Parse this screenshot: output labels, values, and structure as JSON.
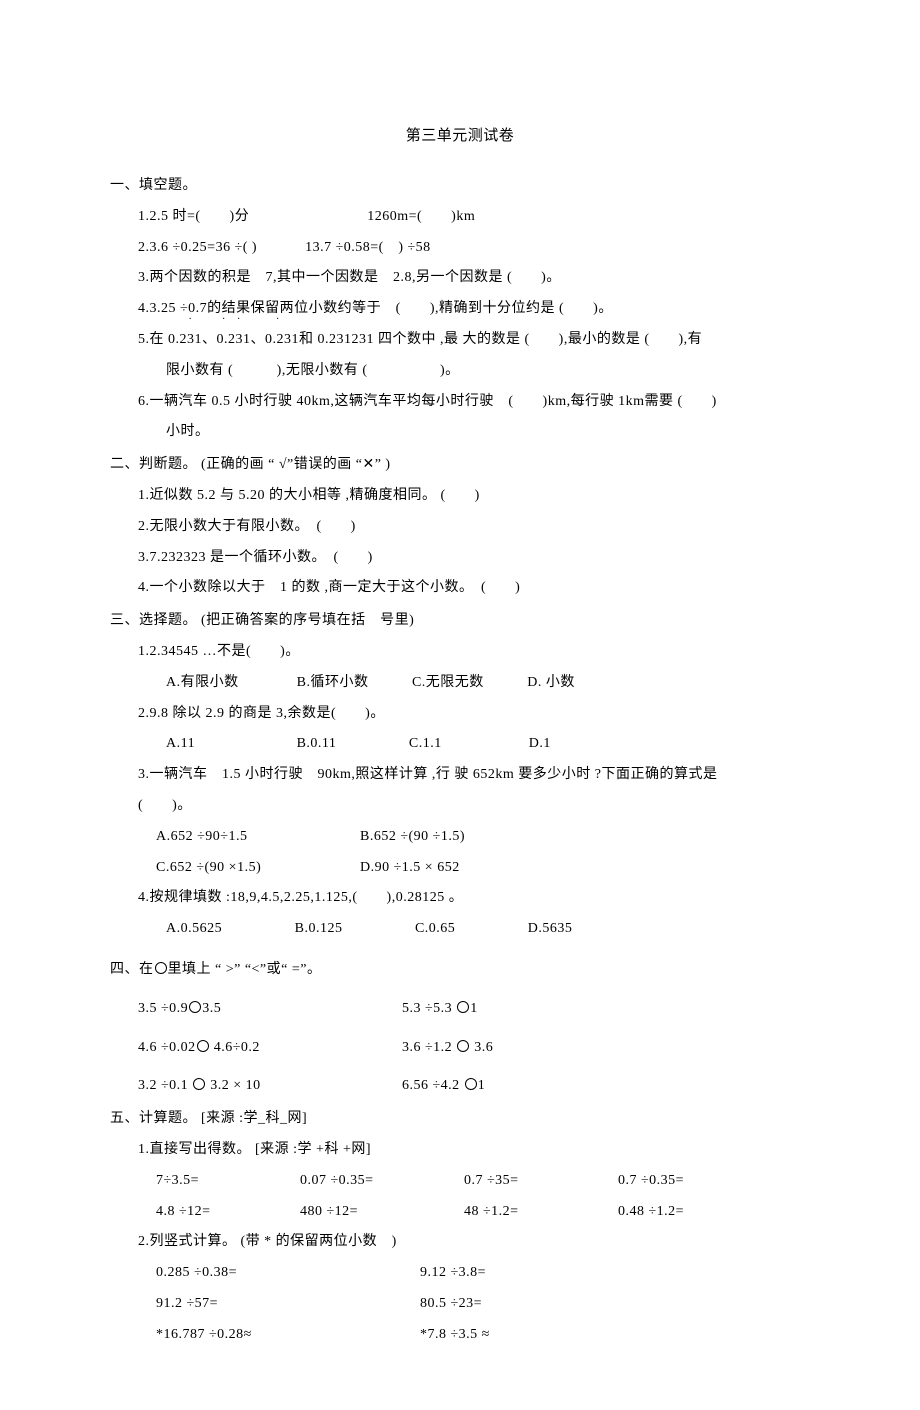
{
  "title": "第三单元测试卷",
  "s1": {
    "head": "一、填空题。",
    "q1a": "1.2.5 时=(　　)分",
    "q1b": "1260m=(　　)km",
    "q2a": "2.3.6 ÷0.25=36 ÷( )",
    "q2b": "13.7 ÷0.58=(　) ÷58",
    "q3": "3.两个因数的积是　7,其中一个因数是　2.8,另一个因数是 (　　)。",
    "q4": "4.3.25 ÷0.7的结果保留两位小数约等于　(　　),精确到十分位约是 (　　)。",
    "q5a": "5.在 0.23",
    "q5b": "、0.",
    "q5c": "3",
    "q5d": "、0.2",
    "q5e": "和 0.231231 四个数中 ,最 大的数是 (　　),最小的数是 (　　),有",
    "q5f": "限小数有 (　　　),无限小数有 (　　　　　)。",
    "q6a": "6.一辆汽车 0.5 小时行驶 40km,这辆汽车平均每小时行驶　(　　)km,每行驶 1km需要 (　　)",
    "q6b": "小时。"
  },
  "s2": {
    "head": "二、判断题。 (正确的画 “ √”错误的画 “✕” )",
    "q1": "1.近似数 5.2 与 5.20 的大小相等 ,精确度相同。 (　　)",
    "q2": "2.无限小数大于有限小数。　(　　)",
    "q3": "3.7.232323 是一个循环小数。　(　　)",
    "q4": "4.一个小数除以大于　1 的数 ,商一定大于这个小数。　(　　)"
  },
  "s3": {
    "head": "三、选择题。 (把正确答案的序号填在括　号里)",
    "q1": "1.2.34545 …不是(　　)。",
    "q1o": "A.有限小数　　　　B.循环小数　　　C.无限无数　　　D. 小数",
    "q2": "2.9.8 除以 2.9 的商是 3,余数是(　　)。",
    "q2o": "A.11　　　　　　　B.0.11　　　　　C.1.1　　　　　　D.1",
    "q3a": "3.一辆汽车　1.5 小时行驶　90km,照这样计算 ,行 驶 652km 要多少小时 ?下面正确的算式是",
    "q3b": "(　　)。",
    "q3oA": "A.652 ÷90÷1.5",
    "q3oB": "B.652 ÷(90 ÷1.5)",
    "q3oC": "C.652 ÷(90 ×1.5)",
    "q3oD": "D.90 ÷1.5 × 652",
    "q4": "4.按规律填数 :18,9,4.5,2.25,1.125,(　　),0.28125 。",
    "q4o": "A.0.5625　　　　　B.0.125　　　　　C.0.65　　　　　D.5635"
  },
  "s4": {
    "head_a": "四、在",
    "head_b": "里填上 “ >” “<”或“ =”。",
    "r1a": "3.5 ÷0.9",
    "r1a2": "3.5",
    "r1b": "5.3 ÷5.3 ",
    "r1b2": "1",
    "r2a": "4.6 ÷0.02",
    "r2a2": " 4.6÷0.2",
    "r2b": "3.6 ÷1.2 ",
    "r2b2": " 3.6",
    "r3a": "3.2 ÷0.1 ",
    "r3a2": " 3.2 × 10",
    "r3b": "6.56 ÷4.2 ",
    "r3b2": "1"
  },
  "s5": {
    "head": "五、计算题。 [来源 :学_科_网]",
    "q1": "1.直接写出得数。 [来源 :学 +科 +网]",
    "q1r1a": "7÷3.5=",
    "q1r1b": "0.07 ÷0.35=",
    "q1r1c": "0.7 ÷35=",
    "q1r1d": "0.7 ÷0.35=",
    "q1r2a": "4.8 ÷12=",
    "q1r2b": "480 ÷12=",
    "q1r2c": "48 ÷1.2=",
    "q1r2d": "0.48 ÷1.2=",
    "q2": "2.列竖式计算。 (带 * 的保留两位小数　)",
    "q2r1a": "0.285 ÷0.38=",
    "q2r1b": "9.12 ÷3.8=",
    "q2r2a": "91.2 ÷57=",
    "q2r2b": "80.5 ÷23=",
    "q2r3a": "*16.787 ÷0.28≈",
    "q2r3b": "*7.8 ÷3.5 ≈"
  }
}
